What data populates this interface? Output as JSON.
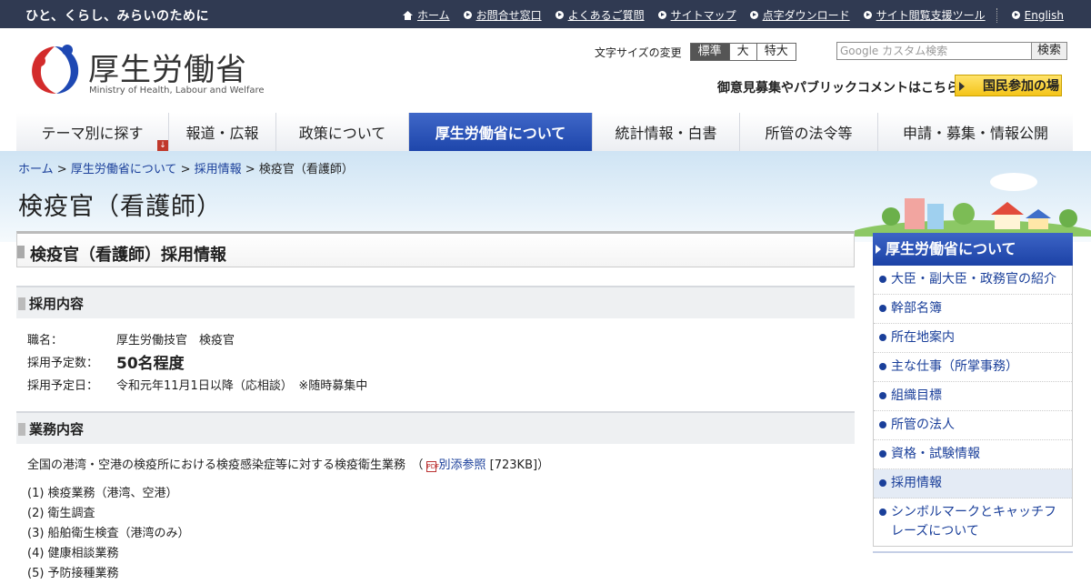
{
  "topbar": {
    "tagline": "ひと、くらし、みらいのために",
    "links": [
      "ホーム",
      "お問合せ窓口",
      "よくあるご質問",
      "サイトマップ",
      "点字ダウンロード",
      "サイト閲覧支援ツール"
    ],
    "english": "English"
  },
  "header": {
    "logo_text": "厚生労働省",
    "logo_sub": "Ministry of Health, Labour and Welfare",
    "fontsize_label": "文字サイズの変更",
    "fontsize_options": [
      "標準",
      "大",
      "特大"
    ],
    "search_placeholder": "Google カスタム検索",
    "search_button": "検索",
    "public_comment": "御意見募集やパブリックコメントはこちら",
    "kokumin_button": "国民参加の場"
  },
  "nav": [
    "テーマ別に探す",
    "報道・広報",
    "政策について",
    "厚生労働省について",
    "統計情報・白書",
    "所管の法令等",
    "申請・募集・情報公開"
  ],
  "breadcrumb": {
    "home": "ホーム",
    "sep": ">",
    "about": "厚生労働省について",
    "recruit": "採用情報",
    "current": "検疫官（看護師）"
  },
  "page_title": "検疫官（看護師）",
  "main": {
    "heading": "検疫官（看護師）採用情報",
    "section1": "採用内容",
    "rows": [
      {
        "k": "職名：",
        "v": "厚生労働技官　検疫官"
      },
      {
        "k": "採用予定数：",
        "v": "50名程度"
      },
      {
        "k": "採用予定日：",
        "v": "令和元年11月1日以降（応相談）　※随時募集中"
      }
    ],
    "section2": "業務内容",
    "desc_prefix": "全国の港湾・空港の検疫所における検疫感染症等に対する検疫衛生業務　（",
    "desc_link": "別添参照",
    "desc_suffix": " [723KB]）",
    "duties": [
      "(1) 検疫業務（港湾、空港）",
      "(2) 衛生調査",
      "(3) 船舶衛生検査（港湾のみ）",
      "(4) 健康相談業務",
      "(5) 予防接種業務"
    ]
  },
  "sidebar": {
    "title": "厚生労働省について",
    "items": [
      "大臣・副大臣・政務官の紹介",
      "幹部名簿",
      "所在地案内",
      "主な仕事（所掌事務）",
      "組織目標",
      "所管の法人",
      "資格・試験情報",
      "採用情報",
      "シンボルマークとキャッチフレーズについて"
    ]
  },
  "colors": {
    "navy": "#303a52",
    "accent": "#1d3a8a",
    "link": "#1a3f9a"
  }
}
